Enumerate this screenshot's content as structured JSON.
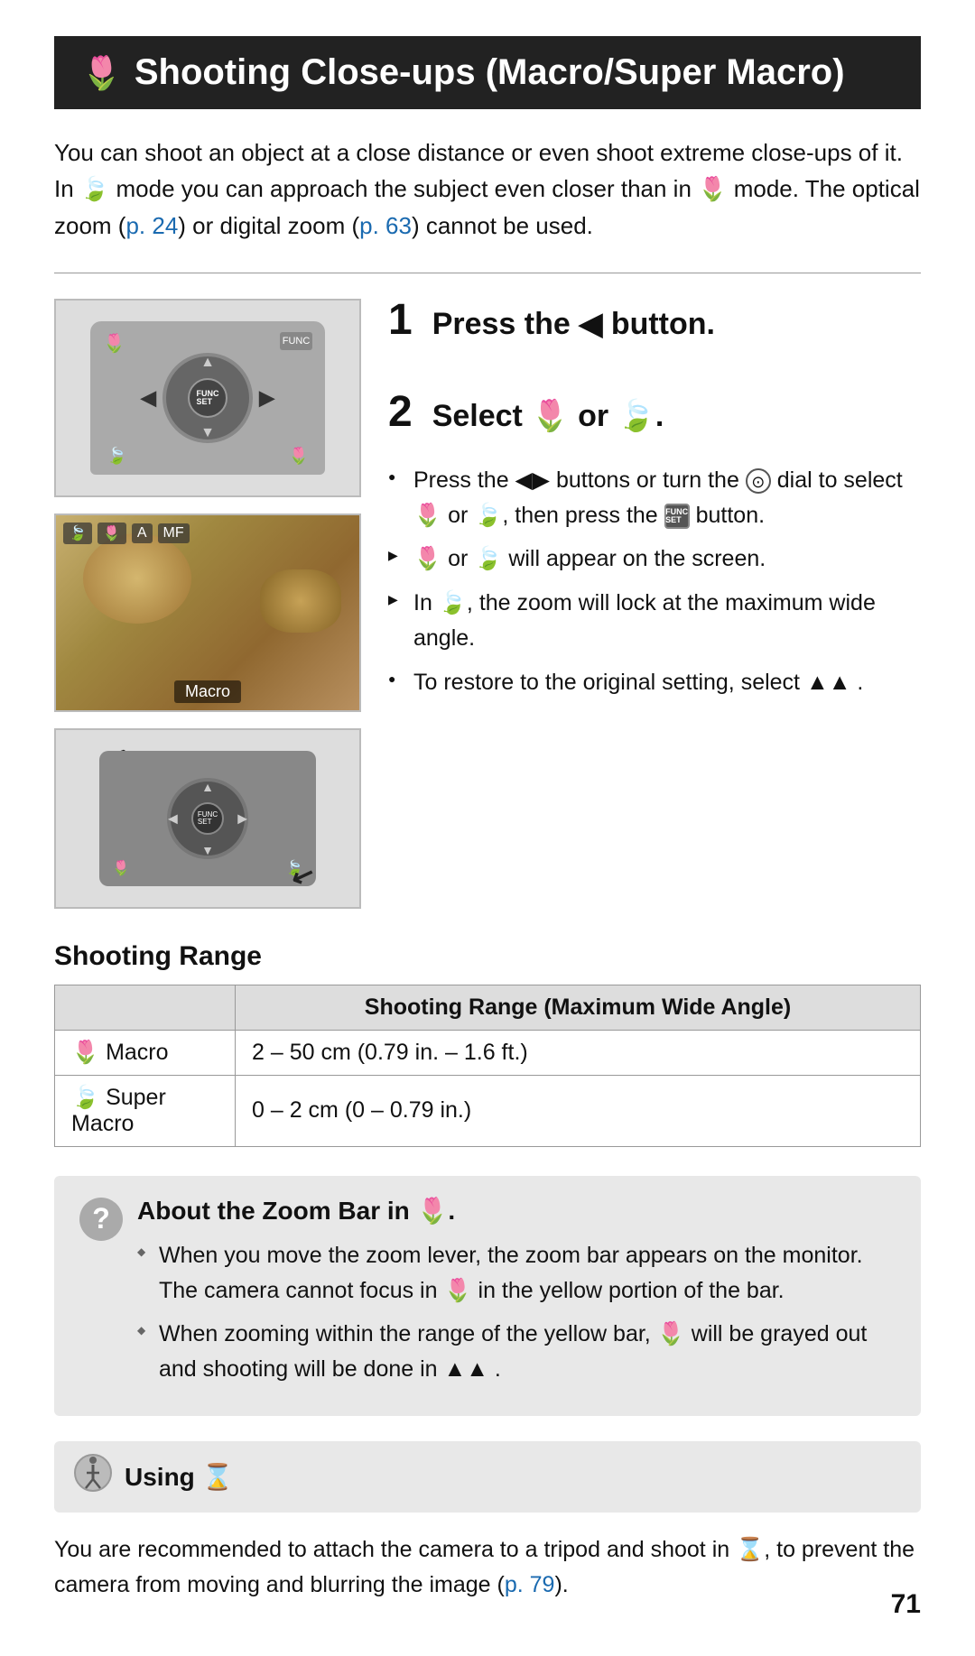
{
  "page": {
    "title": "Shooting Close-ups (Macro/Super Macro)",
    "title_icon": "🌷",
    "page_number": "71",
    "intro": "You can shoot an object at a close distance or even shoot extreme close-ups of it. In 🍃 mode you can approach the subject even closer than in 🌷 mode. The optical zoom (p. 24) or digital zoom (p. 63) cannot be used.",
    "intro_p24": "p. 24",
    "intro_p63": "p. 63",
    "step1": {
      "number": "1",
      "title": "Press the ◀ button."
    },
    "step2": {
      "number": "2",
      "title": "Select 🌷 or 🍃.",
      "bullets": [
        {
          "type": "circle",
          "text": "Press the ◀▶ buttons or turn the ⊙ dial to select 🌷 or 🍃, then press the FUNC/SET button."
        },
        {
          "type": "arrow",
          "text": "🌷 or 🍃 will appear on the screen."
        },
        {
          "type": "arrow",
          "text": "In 🍃, the zoom will lock at the maximum wide angle."
        },
        {
          "type": "circle",
          "text": "To restore to the original setting, select ▲▲."
        }
      ]
    },
    "shooting_range": {
      "section_title": "Shooting Range",
      "table_header": "Shooting Range (Maximum Wide Angle)",
      "rows": [
        {
          "mode": "🌷 Macro",
          "range": "2 – 50 cm (0.79 in. – 1.6 ft.)"
        },
        {
          "mode": "🍃 Super Macro",
          "range": "0 – 2 cm (0 – 0.79 in.)"
        }
      ]
    },
    "zoom_bar_box": {
      "icon": "?",
      "title": "About the Zoom Bar in 🌷.",
      "bullets": [
        "When you move the zoom lever, the zoom bar appears on the monitor. The camera cannot focus in 🌷 in the yellow portion of the bar.",
        "When zooming within the range of the yellow bar, 🌷 will be grayed out and shooting will be done in ▲▲."
      ]
    },
    "using_box": {
      "icon": "⏱",
      "title": "Using ⏲",
      "body": "You are recommended to attach the camera to a tripod and shoot in ⏲, to prevent the camera from moving and blurring the image (p. 79).",
      "p79": "p. 79"
    }
  }
}
